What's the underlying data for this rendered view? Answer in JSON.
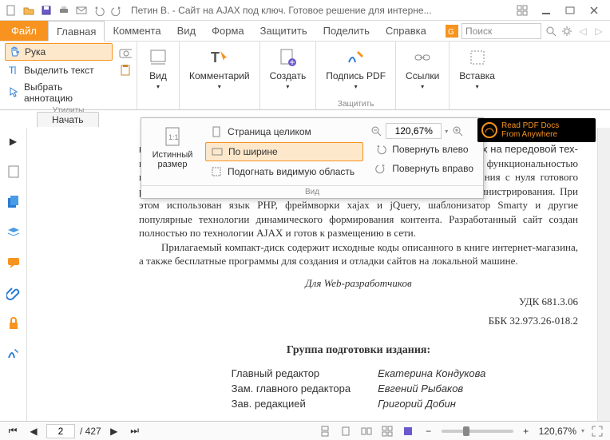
{
  "title": "Петин В. - Сайт на AJAX под ключ. Готовое решение для интерне...",
  "menu": {
    "file": "Файл",
    "tabs": [
      "Главная",
      "Коммента",
      "Вид",
      "Форма",
      "Защитить",
      "Поделить",
      "Справка"
    ],
    "search_placeholder": "Поиск"
  },
  "ribbon": {
    "tools": {
      "hand": "Рука",
      "select_text": "Выделить текст",
      "select_ann": "Выбрать аннотацию",
      "group": "Утилиты"
    },
    "view": "Вид",
    "comment": "Комментарий",
    "create": "Создать",
    "sign": "Подпись PDF",
    "sign_group": "Защитить",
    "links": "Ссылки",
    "insert": "Вставка"
  },
  "dropdown": {
    "actual": "Истинный размер",
    "whole": "Страница целиком",
    "fit_width": "По ширине",
    "fit_visible": "Подогнать видимую область",
    "zoom_value": "120,67%",
    "rot_left": "Повернуть влево",
    "rot_right": "Повернуть вправо",
    "foot": "Вид"
  },
  "promo": {
    "l1": "Read PDF Docs",
    "l2": "From Anywhere"
  },
  "start_tab": "Начать",
  "doc": {
    "frag0": "пр",
    "frag1": "ых на передовой тех-",
    "p1": "нологии AJAX, работающих без перезагрузки страниц и обладающих функциональностью настольных приложений. Обучение построено на сквозном примере создания с нуля готового решения: интернет-магазина цифровых товаров, а также системы его администрирования. При этом использован язык PHP, фреймворки xajax и jQuery, шаблонизатор Smarty и другие популярные технологии динамического формирования контента. Разработанный сайт создан полностью по технологии AJAX и готов к размещению в сети.",
    "p2": "Прилагаемый компакт-диск содержит исходные коды описанного в книге интернет-магазина, а также бесплатные программы для создания и отладки сайтов на локальной машине.",
    "audience": "Для Web-разработчиков",
    "udk": "УДК 681.3.06",
    "bbk": "ББК 32.973.26-018.2",
    "group_title": "Группа подготовки издания:",
    "roles": [
      [
        "Главный редактор",
        "Екатерина Кондукова"
      ],
      [
        "Зам. главного редактора",
        "Евгений Рыбаков"
      ],
      [
        "Зав. редакцией",
        "Григорий Добин"
      ]
    ]
  },
  "status": {
    "page": "2",
    "total": "/ 427",
    "zoom": "120,67%"
  }
}
